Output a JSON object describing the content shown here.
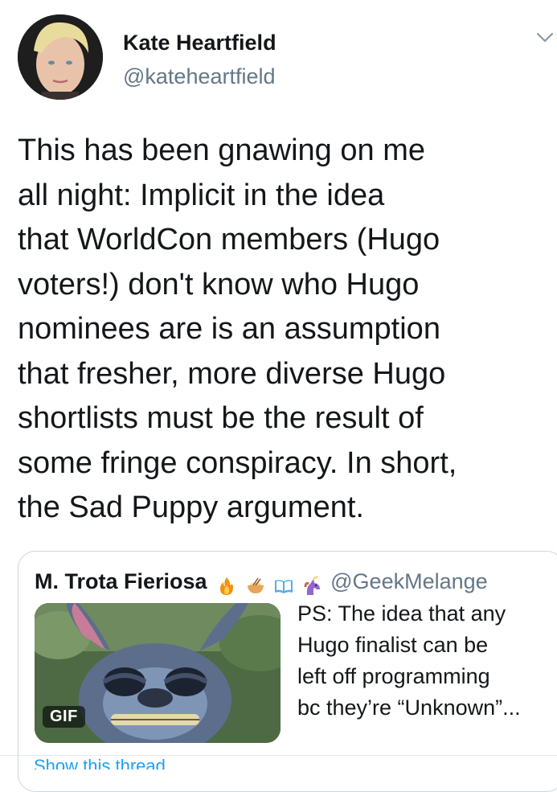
{
  "author": {
    "display_name": "Kate Heartfield",
    "handle": "@kateheartfield"
  },
  "tweet": {
    "lines": [
      "This has been gnawing on me",
      "all night: Implicit in the idea",
      "that WorldCon members (Hugo",
      "voters!) don't know who Hugo",
      "nominees are is an assumption",
      "that fresher, more diverse Hugo",
      "shortlists must be the result of",
      "some fringe conspiracy. In short,",
      "the Sad Puppy argument."
    ]
  },
  "quoted_tweet": {
    "display_name": "M. Trota Fieriosa",
    "name_emojis": [
      "fire-emoji",
      "ramen-emoji",
      "book-emoji",
      "unicorn-emoji"
    ],
    "handle": "@GeekMelange",
    "media_badge": "GIF",
    "text_lines": [
      "PS: The idea that any",
      "Hugo finalist can be",
      "left off programming",
      "bc they’re “Unknown”..."
    ]
  },
  "footer": {
    "cutoff_link": "Show this thread"
  },
  "colors": {
    "text": "#14171a",
    "secondary": "#657786",
    "border": "#ccd6dd",
    "link": "#1da1f2"
  }
}
